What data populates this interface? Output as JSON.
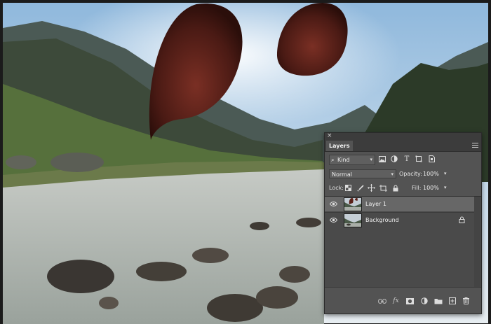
{
  "panel": {
    "close_label": "×",
    "tab_label": "Layers",
    "filter": {
      "kind_label": "Kind"
    },
    "blend_mode": "Normal",
    "opacity_label": "Opacity:",
    "opacity_value": "100%",
    "lock_label": "Lock:",
    "fill_label": "Fill:",
    "fill_value": "100%",
    "layers": [
      {
        "name": "Layer 1",
        "selected": true,
        "visible": true
      },
      {
        "name": "Background",
        "selected": false,
        "visible": true,
        "locked": true
      }
    ],
    "bottom_icons": [
      "link-icon",
      "fx-icon",
      "mask-icon",
      "adjustment-icon",
      "folder-icon",
      "new-layer-icon",
      "trash-icon"
    ],
    "fx_label": "fx"
  },
  "colors": {
    "panel_bg": "#535353",
    "panel_header": "#3c3c3c",
    "selected_row": "#676767"
  }
}
